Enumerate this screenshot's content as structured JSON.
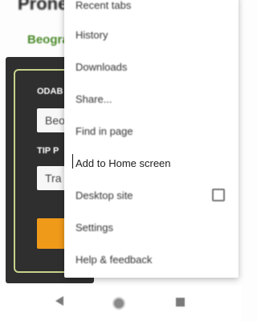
{
  "background_page": {
    "title_fragment": "Prone",
    "subtitle_fragment": "Beogra",
    "form": {
      "label_1": "ODAB",
      "input_1": "Beo",
      "label_2": "TIP P",
      "input_2": "Tra"
    }
  },
  "menu": {
    "items": [
      {
        "label": "Recent tabs"
      },
      {
        "label": "History"
      },
      {
        "label": "Downloads"
      },
      {
        "label": "Share..."
      },
      {
        "label": "Find in page"
      },
      {
        "label": "Add to Home screen"
      },
      {
        "label": "Desktop site",
        "checked": false
      },
      {
        "label": "Settings"
      },
      {
        "label": "Help & feedback"
      }
    ]
  },
  "navbar": {
    "back_icon": "back-triangle-icon",
    "home_icon": "home-circle-icon",
    "recent_icon": "recent-apps-square-icon"
  }
}
